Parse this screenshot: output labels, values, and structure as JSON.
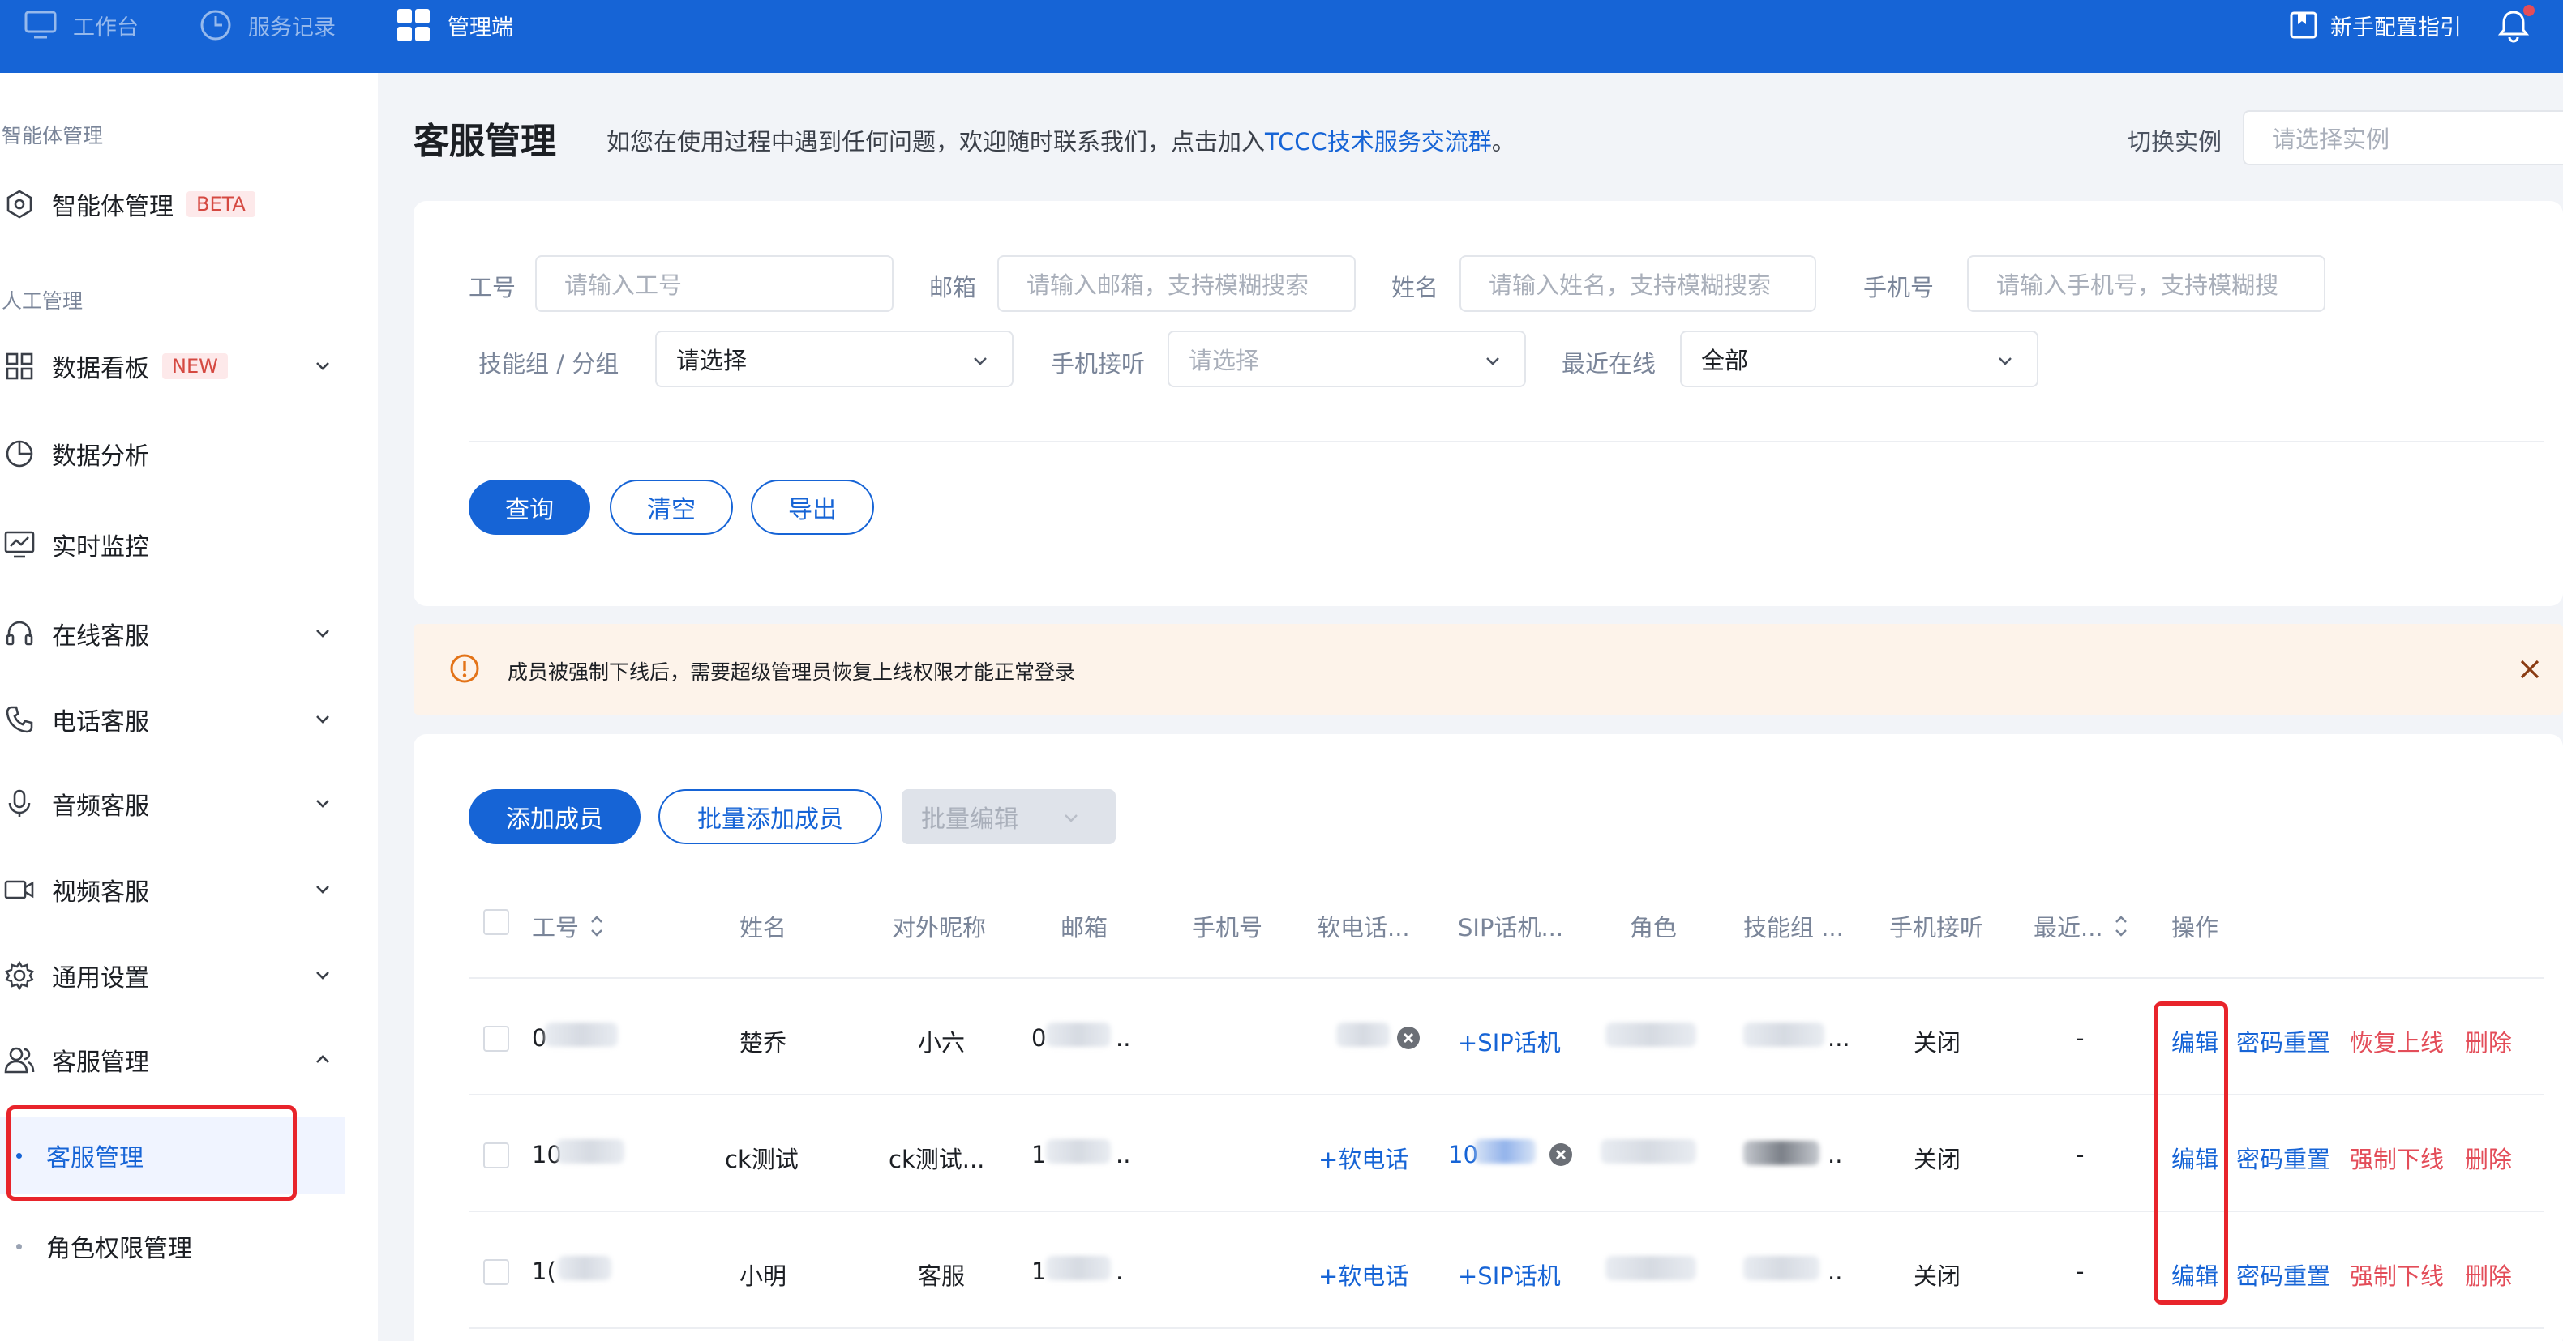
{
  "topbar": {
    "nav": [
      {
        "label": "工作台",
        "icon": "monitor-icon"
      },
      {
        "label": "服务记录",
        "icon": "clock-icon"
      },
      {
        "label": "管理端",
        "icon": "grid-icon"
      }
    ],
    "guide_label": "新手配置指引",
    "notification_icon": "bell-icon"
  },
  "sidebar": {
    "section_agent": "智能体管理",
    "agent_item": {
      "label": "智能体管理",
      "tag": "BETA"
    },
    "section_human": "人工管理",
    "items": [
      {
        "label": "数据看板",
        "tag": "NEW"
      },
      {
        "label": "数据分析"
      },
      {
        "label": "实时监控"
      },
      {
        "label": "在线客服"
      },
      {
        "label": "电话客服"
      },
      {
        "label": "音频客服"
      },
      {
        "label": "视频客服"
      },
      {
        "label": "通用设置"
      },
      {
        "label": "客服管理"
      }
    ],
    "sub_items": [
      {
        "label": "客服管理",
        "active": true
      },
      {
        "label": "角色权限管理",
        "active": false
      }
    ]
  },
  "header": {
    "title": "客服管理",
    "desc_prefix": "如您在使用过程中遇到任何问题，欢迎随时联系我们，点击加入",
    "desc_link": "TCCC技术服务交流群",
    "desc_suffix": "。",
    "switch_label": "切换实例",
    "switch_placeholder": "请选择实例"
  },
  "filters": {
    "job_no": {
      "label": "工号",
      "placeholder": "请输入工号"
    },
    "email": {
      "label": "邮箱",
      "placeholder": "请输入邮箱，支持模糊搜索"
    },
    "name": {
      "label": "姓名",
      "placeholder": "请输入姓名，支持模糊搜索"
    },
    "phone": {
      "label": "手机号",
      "placeholder": "请输入手机号，支持模糊搜"
    },
    "skill_group": {
      "label": "技能组 / 分组",
      "value": "请选择"
    },
    "phone_answer": {
      "label": "手机接听",
      "value": "请选择"
    },
    "last_online": {
      "label": "最近在线",
      "value": "全部"
    },
    "query_button": "查询",
    "clear_button": "清空",
    "export_button": "导出"
  },
  "alert": {
    "text": "成员被强制下线后，需要超级管理员恢复上线权限才能正常登录"
  },
  "toolbar": {
    "add_member": "添加成员",
    "batch_add": "批量添加成员",
    "batch_edit": "批量编辑"
  },
  "table": {
    "columns": [
      "工号",
      "姓名",
      "对外昵称",
      "邮箱",
      "手机号",
      "软电话...",
      "SIP话机...",
      "角色",
      "技能组 ...",
      "手机接听",
      "最近...",
      "操作"
    ],
    "rows": [
      {
        "job_no": "0",
        "name": "楚乔",
        "nickname": "小六",
        "email": "0",
        "email_tail": "..",
        "softphone": "",
        "sip": "+SIP话机",
        "skill_tail": "...",
        "phone_answer": "关闭",
        "last_online": "-",
        "actions": [
          "编辑",
          "密码重置",
          "恢复上线",
          "删除"
        ]
      },
      {
        "job_no": "10",
        "name": "ck测试",
        "nickname": "ck测试...",
        "email": "1",
        "email_tail": "..",
        "softphone": "+软电话",
        "sip": "10",
        "skill_tail": "..",
        "phone_answer": "关闭",
        "last_online": "-",
        "actions": [
          "编辑",
          "密码重置",
          "强制下线",
          "删除"
        ]
      },
      {
        "job_no": "1(",
        "name": "小明",
        "nickname": "客服",
        "email": "1",
        "email_tail": ".",
        "softphone": "+软电话",
        "sip": "+SIP话机",
        "skill_tail": "..",
        "phone_answer": "关闭",
        "last_online": "-",
        "actions": [
          "编辑",
          "密码重置",
          "强制下线",
          "删除"
        ]
      }
    ]
  },
  "colors": {
    "primary": "#1664d6",
    "danger": "#e34d59",
    "annotation": "#e8242b"
  }
}
